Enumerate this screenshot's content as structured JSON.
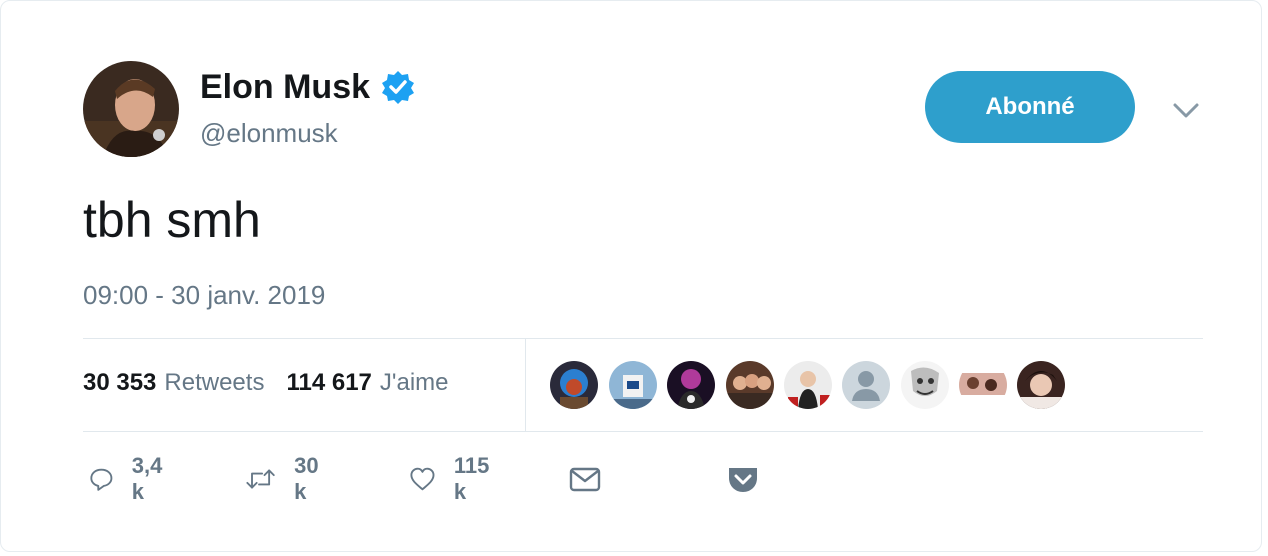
{
  "user": {
    "name": "Elon Musk",
    "handle": "@elonmusk",
    "verified": true
  },
  "follow_button_label": "Abonné",
  "tweet": {
    "text": "tbh smh",
    "timestamp": "09:00 - 30 janv. 2019"
  },
  "stats": {
    "retweets_count": "30 353",
    "retweets_label": "Retweets",
    "likes_count": "114 617",
    "likes_label": "J'aime"
  },
  "actions": {
    "replies": "3,4 k",
    "retweets": "30 k",
    "likes": "115 k"
  },
  "colors": {
    "accent": "#2e9fcc",
    "verified": "#1da1f2",
    "text_primary": "#14171a",
    "text_secondary": "#657786",
    "divider": "#e1e8ed"
  }
}
